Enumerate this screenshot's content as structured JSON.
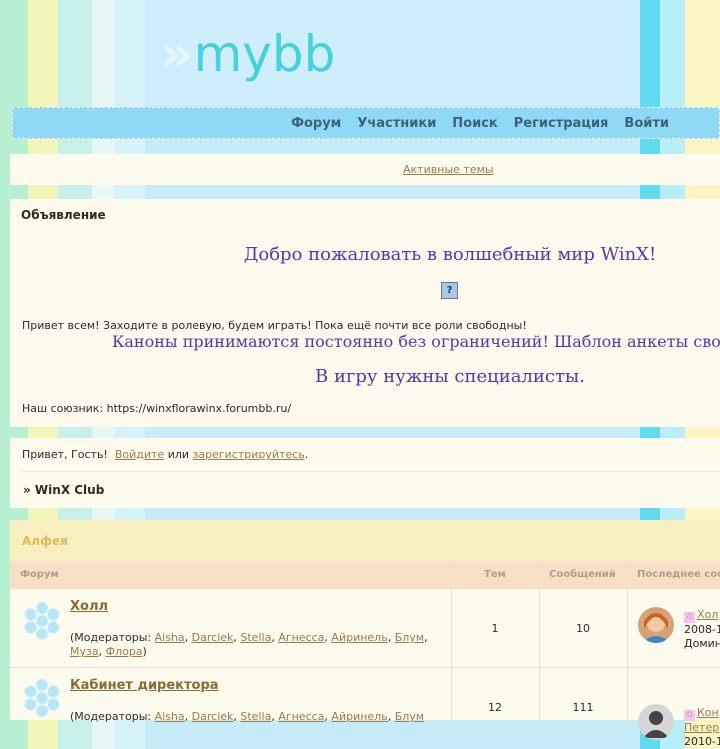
{
  "logo": {
    "text": "mybb"
  },
  "nav": [
    "Форум",
    "Участники",
    "Поиск",
    "Регистрация",
    "Войти"
  ],
  "active_topics": "Активные темы",
  "announcement": {
    "title": "Объявление",
    "welcome": "Добро пожаловать в волшебный мир WinX!",
    "image_placeholder": "?",
    "text1": "Привет всем! Заходите в ролевую, будем играть! Пока ещё почти все роли свободны!",
    "canons": "Каноны принимаются постоянно без ограничений! Шаблон анкеты сво",
    "specialists": "В игру нужны специалисты.",
    "ally": "Наш союзник: https://winxflorawinx.forumbb.ru/"
  },
  "guest": {
    "greeting": "Привет, Гость!",
    "login_link": "Войдите",
    "or": "или",
    "register_link": "зарегистрируйтесь",
    "period": "."
  },
  "breadcrumb": "» WinX Club",
  "category": {
    "title": "Алфея",
    "columns": {
      "forum": "Форум",
      "topics": "Тем",
      "posts": "Сообщений",
      "last": "Последнее соо"
    },
    "forums": [
      {
        "name": "Холл",
        "mods_prefix": "(Модераторы:",
        "mods": [
          "Aisha",
          "Darciek",
          "Stella",
          "Агнесса",
          "Айринель",
          "Блум",
          "Муза",
          "Флора"
        ],
        "mods_suffix": ")",
        "topics": "1",
        "posts": "10",
        "last_title": "Хол",
        "last_date": "2008-1",
        "last_author": "Домин"
      },
      {
        "name": "Кабинет директора",
        "mods_prefix": "(Модераторы:",
        "mods": [
          "Aisha",
          "Darciek",
          "Stella",
          "Агнесса",
          "Айринель",
          "Блум"
        ],
        "mods_suffix": "",
        "topics": "12",
        "posts": "111",
        "last_title": "Кон",
        "last_author": "Петер",
        "last_date": "2010-1"
      }
    ]
  },
  "colors": {
    "nav_bg": "#8fd8f6",
    "logo": "#45d2de",
    "announce_text": "#5b35a8",
    "link": "#9b7b46",
    "category_title": "#e0b85c"
  }
}
